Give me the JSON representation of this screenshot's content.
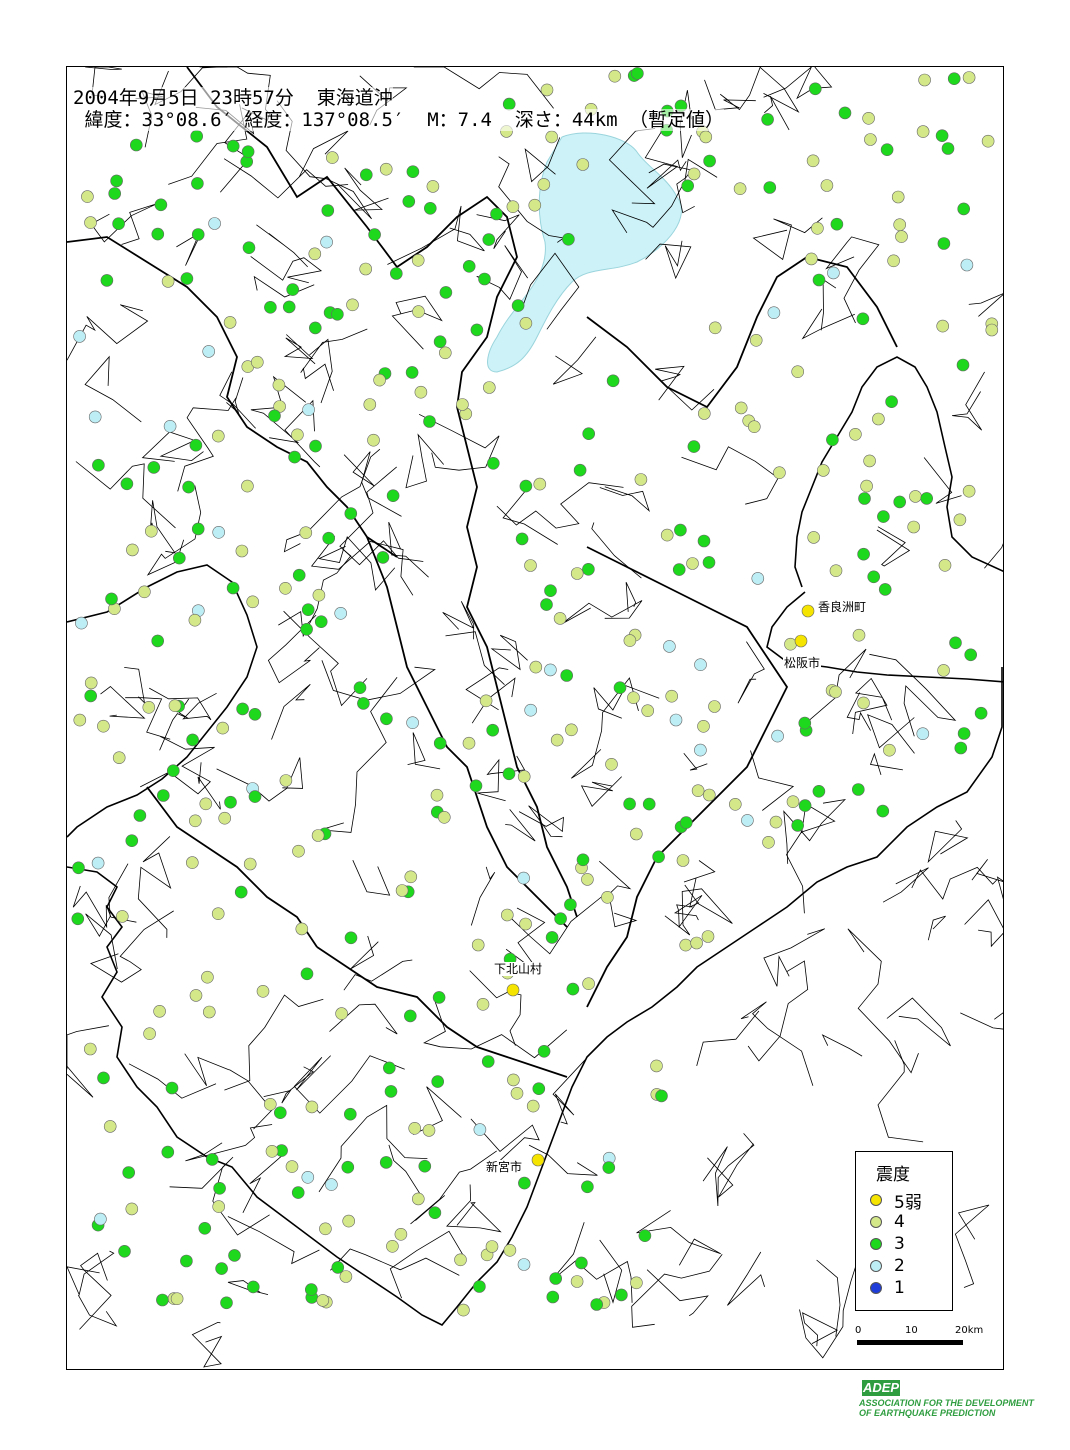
{
  "map_title": {
    "line1": "2004年9月5日 23時57分  東海道沖",
    "line2": " 緯度：33°08.6′ 経度：137°08.5′  M：7.4  深さ：44km （暫定値）"
  },
  "colors": {
    "shindo_5weak": "#f5e400",
    "shindo_4": "#d4e88a",
    "shindo_3": "#1ed81e",
    "shindo_2": "#bdeef5",
    "shindo_1": "#1e3cd8",
    "lake": "#cdf2f8",
    "boundary": "#000000"
  },
  "place_labels": {
    "kouracho": "香良洲町",
    "matsusaka": "松阪市",
    "shimokitayama": "下北山村",
    "shingu": "新宮市"
  },
  "legend": {
    "title": "震度",
    "items": [
      {
        "label": "5弱",
        "level": "5-"
      },
      {
        "label": "4",
        "level": "4"
      },
      {
        "label": "3",
        "level": "3"
      },
      {
        "label": "2",
        "level": "2"
      },
      {
        "label": "1",
        "level": "1"
      }
    ]
  },
  "scale": {
    "ticks": [
      "0",
      "10",
      "20km"
    ]
  },
  "logo": {
    "name": "ADEP",
    "line1": "ASSOCIATION FOR THE DEVELOPMENT",
    "line2": "OF EARTHQUAKE PREDICTION"
  },
  "stations": [
    {
      "level": "5-",
      "place": "香良洲町"
    },
    {
      "level": "5-",
      "place": "松阪市"
    },
    {
      "level": "5-",
      "place": "下北山村"
    },
    {
      "level": "5-",
      "place": "新宮市"
    }
  ]
}
